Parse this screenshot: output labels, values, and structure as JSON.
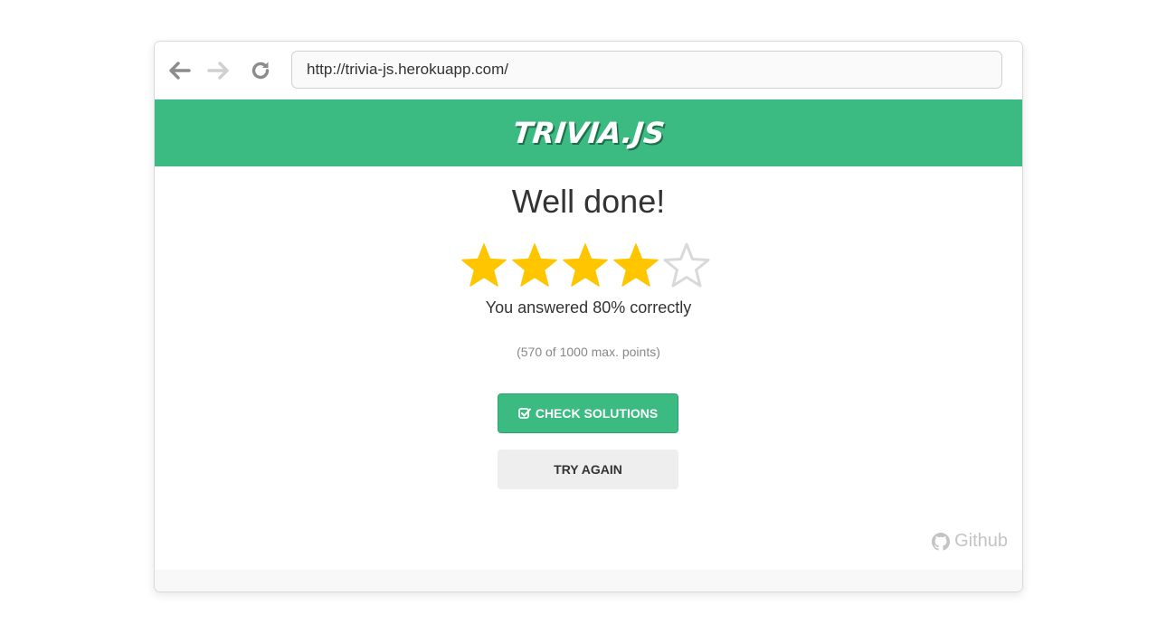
{
  "browser": {
    "url": "http://trivia-js.herokuapp.com/",
    "icons": {
      "back": "arrow-left-icon",
      "forward": "arrow-right-icon",
      "reload": "reload-icon"
    }
  },
  "header": {
    "logo_text": "TRIVIA.JS",
    "background_color": "#3bbb81"
  },
  "result": {
    "title": "Well done!",
    "rating": {
      "filled": 4,
      "total": 5
    },
    "summary": "You answered 80% correctly",
    "points": "(570 of 1000 max. points)"
  },
  "actions": {
    "check_solutions_label": "CHECK SOLUTIONS",
    "check_solutions_icon": "check-square-icon",
    "try_again_label": "TRY AGAIN"
  },
  "footer": {
    "github_label": "Github",
    "github_icon": "github-icon"
  },
  "colors": {
    "accent": "#3bbb81",
    "star_filled": "#ffc600",
    "star_empty": "#d9d9d9"
  }
}
